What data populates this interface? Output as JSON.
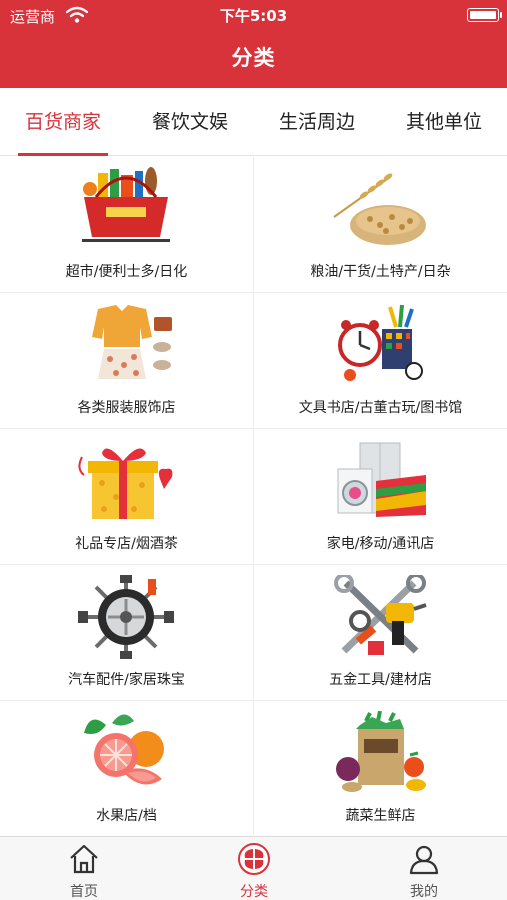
{
  "status_bar": {
    "carrier": "运营商",
    "time": "下午5:03"
  },
  "header": {
    "title": "分类"
  },
  "tabs": [
    {
      "label": "百货商家",
      "active": true
    },
    {
      "label": "餐饮文娱",
      "active": false
    },
    {
      "label": "生活周边",
      "active": false
    },
    {
      "label": "其他单位",
      "active": false
    }
  ],
  "categories": [
    {
      "label": "超市/便利士多/日化",
      "icon": "supermarket-basket"
    },
    {
      "label": "粮油/干货/土特产/日杂",
      "icon": "wheat-grain"
    },
    {
      "label": "各类服装服饰店",
      "icon": "clothing"
    },
    {
      "label": "文具书店/古董古玩/图书馆",
      "icon": "stationery"
    },
    {
      "label": "礼品专店/烟酒茶",
      "icon": "gift-box"
    },
    {
      "label": "家电/移动/通讯店",
      "icon": "appliances"
    },
    {
      "label": "汽车配件/家居珠宝",
      "icon": "car-parts"
    },
    {
      "label": "五金工具/建材店",
      "icon": "hardware-tools"
    },
    {
      "label": "水果店/档",
      "icon": "fruit"
    },
    {
      "label": "蔬菜生鲜店",
      "icon": "vegetables"
    }
  ],
  "tabbar": [
    {
      "label": "首页",
      "icon": "home-icon",
      "active": false
    },
    {
      "label": "分类",
      "icon": "category-icon",
      "active": true
    },
    {
      "label": "我的",
      "icon": "user-icon",
      "active": false
    }
  ],
  "colors": {
    "brand": "#d8323b",
    "divider": "#ececec",
    "tab_inactive": "#555555"
  }
}
